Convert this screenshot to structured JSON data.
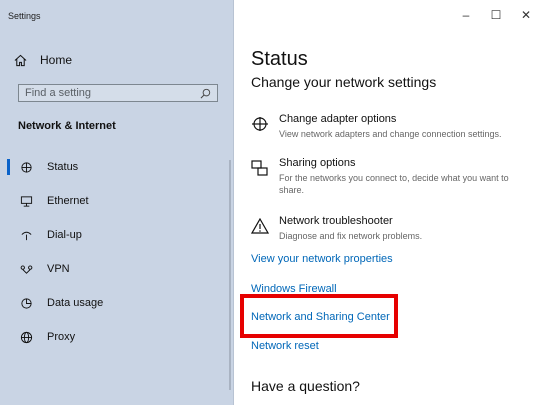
{
  "window": {
    "title": "Settings"
  },
  "sidebar": {
    "home_label": "Home",
    "search_placeholder": "Find a setting",
    "section_title": "Network & Internet",
    "items": [
      {
        "label": "Status",
        "icon": "status-icon",
        "selected": true
      },
      {
        "label": "Ethernet",
        "icon": "ethernet-icon"
      },
      {
        "label": "Dial-up",
        "icon": "dial-up-icon"
      },
      {
        "label": "VPN",
        "icon": "vpn-icon"
      },
      {
        "label": "Data usage",
        "icon": "data-usage-icon"
      },
      {
        "label": "Proxy",
        "icon": "globe-icon"
      }
    ]
  },
  "main": {
    "title": "Status",
    "subtitle": "Change your network settings",
    "options": [
      {
        "title": "Change adapter options",
        "description": "View network adapters and change connection settings.",
        "icon": "adapter-icon"
      },
      {
        "title": "Sharing options",
        "description": "For the networks you connect to, decide what you want to share.",
        "icon": "sharing-icon"
      },
      {
        "title": "Network troubleshooter",
        "description": "Diagnose and fix network problems.",
        "icon": "warning-icon"
      }
    ],
    "links": {
      "network_properties": "View your network properties",
      "firewall": "Windows Firewall",
      "sharing_center": "Network and Sharing Center",
      "reset": "Network reset"
    },
    "question": "Have a question?"
  },
  "colors": {
    "sidebar_bg": "#c9d4e4",
    "accent": "#0a62c9",
    "link": "#0067b8",
    "highlight": "#e60000"
  }
}
